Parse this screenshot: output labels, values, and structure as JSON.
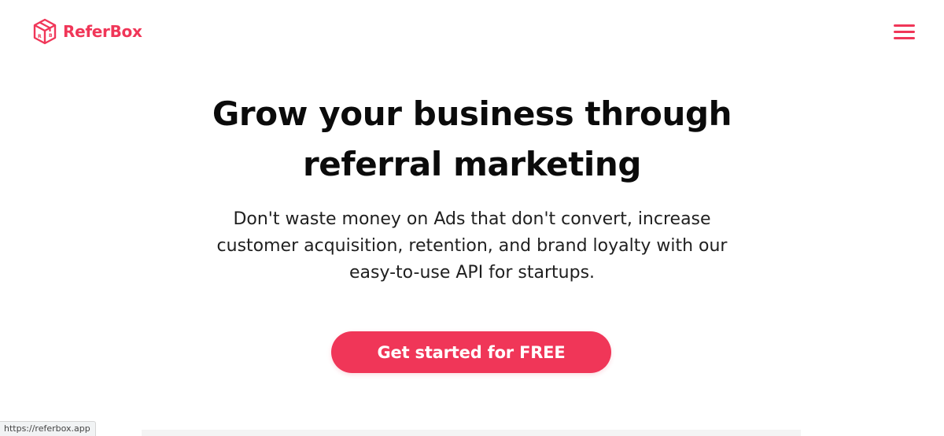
{
  "brand": {
    "name": "ReferBox",
    "logo_icon": "box-icon",
    "color": "#f03658"
  },
  "header": {
    "menu_icon": "hamburger-menu-icon"
  },
  "hero": {
    "title_line1": "Grow your business through",
    "title_line2": "referral marketing",
    "subtitle_line1": "Don't waste money on Ads that don't convert, increase",
    "subtitle_line2": "customer acquisition, retention, and brand loyalty with our",
    "subtitle_line3": "easy-to-use API for startups.",
    "cta_label": "Get started for FREE"
  },
  "colors": {
    "accent": "#f03658",
    "title_text": "#0b0b0b",
    "body_text": "#1f1f1f",
    "background": "#ffffff"
  },
  "status_bar": {
    "url": "https://referbox.app"
  }
}
